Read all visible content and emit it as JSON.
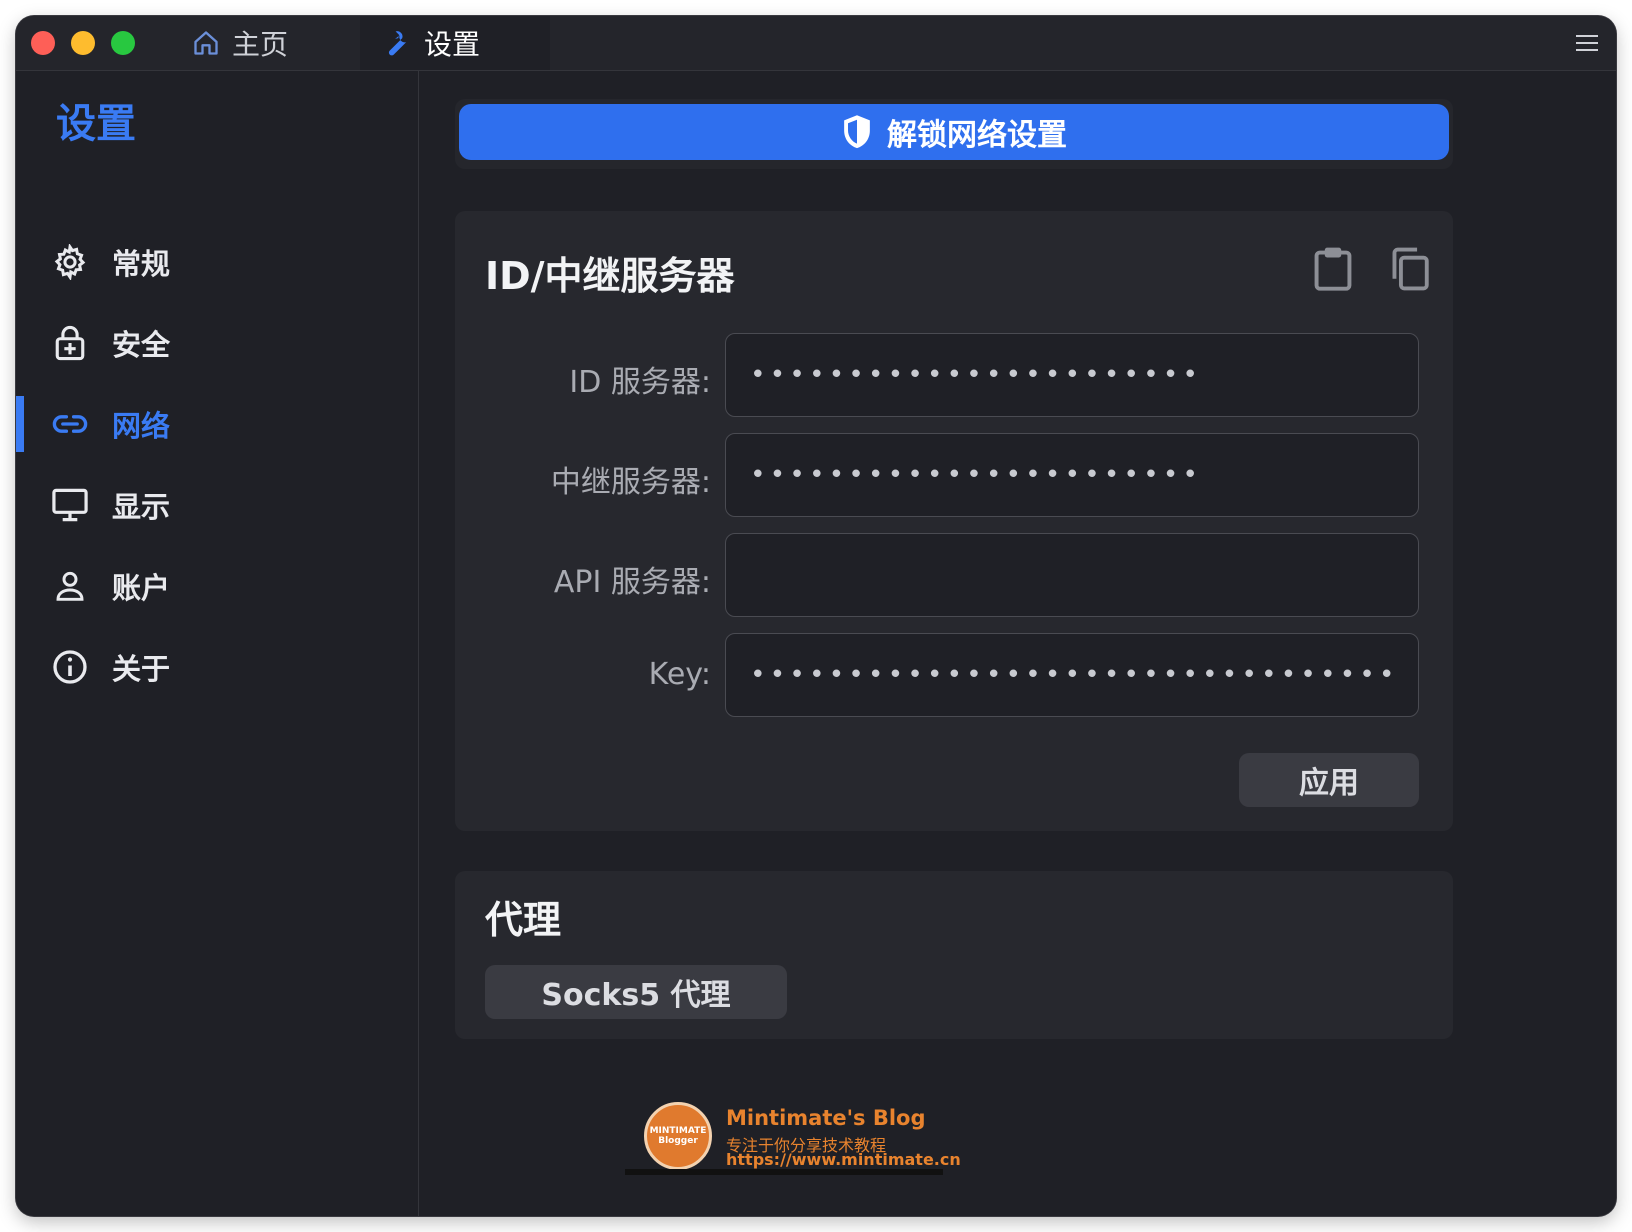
{
  "tabs": [
    {
      "label": "主页",
      "icon": "home-icon"
    },
    {
      "label": "设置",
      "icon": "wrench-icon"
    }
  ],
  "sidebar": {
    "title": "设置",
    "items": [
      {
        "label": "常规",
        "icon": "gear-icon"
      },
      {
        "label": "安全",
        "icon": "lock-icon"
      },
      {
        "label": "网络",
        "icon": "link-icon",
        "active": true
      },
      {
        "label": "显示",
        "icon": "monitor-icon"
      },
      {
        "label": "账户",
        "icon": "user-icon"
      },
      {
        "label": "关于",
        "icon": "info-icon"
      }
    ]
  },
  "unlock": {
    "label": "解锁网络设置",
    "icon": "shield-icon"
  },
  "server_card": {
    "title": "ID/中继服务器",
    "fields": [
      {
        "label": "ID 服务器:",
        "value": "•••••••••••••••••••••••"
      },
      {
        "label": "中继服务器:",
        "value": "•••••••••••••••••••••••"
      },
      {
        "label": "API 服务器:",
        "value": ""
      },
      {
        "label": "Key:",
        "value": "•••••••••••••••••••••••••••••••••••••••••••••"
      }
    ],
    "apply_label": "应用"
  },
  "proxy_card": {
    "title": "代理",
    "socks_label": "Socks5 代理"
  },
  "watermark": {
    "logo_text": "MINTIMATE",
    "logo_sub": "Blogger",
    "title": "Mintimate's Blog",
    "subtitle": "专注于你分享技术教程",
    "url": "https://www.mintimate.cn"
  },
  "colors": {
    "accent": "#2f6fee",
    "active_nav": "#3a7bf3",
    "background": "#1f2026",
    "card": "#27282e"
  }
}
